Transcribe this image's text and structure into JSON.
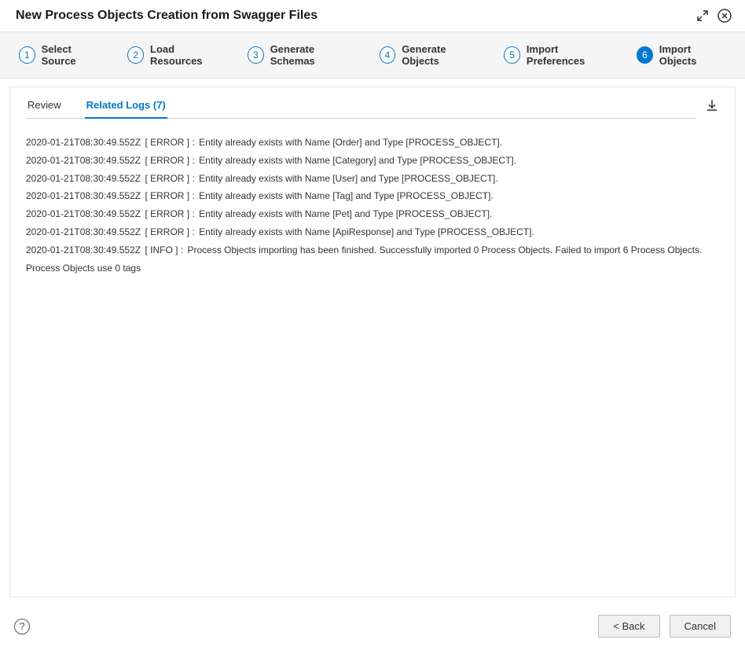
{
  "header": {
    "title": "New Process Objects Creation from Swagger Files"
  },
  "steps": [
    {
      "num": "1",
      "label": "Select Source",
      "active": false
    },
    {
      "num": "2",
      "label": "Load Resources",
      "active": false
    },
    {
      "num": "3",
      "label": "Generate Schemas",
      "active": false
    },
    {
      "num": "4",
      "label": "Generate Objects",
      "active": false
    },
    {
      "num": "5",
      "label": "Import Preferences",
      "active": false
    },
    {
      "num": "6",
      "label": "Import Objects",
      "active": true
    }
  ],
  "tabs": {
    "review": "Review",
    "related_logs": "Related Logs (7)"
  },
  "logs": [
    {
      "ts": "2020-01-21T08:30:49.552Z",
      "level": "[ ERROR ] :",
      "msg": "Entity already exists with Name [Order] and Type [PROCESS_OBJECT]."
    },
    {
      "ts": "2020-01-21T08:30:49.552Z",
      "level": "[ ERROR ] :",
      "msg": "Entity already exists with Name [Category] and Type [PROCESS_OBJECT]."
    },
    {
      "ts": "2020-01-21T08:30:49.552Z",
      "level": "[ ERROR ] :",
      "msg": "Entity already exists with Name [User] and Type [PROCESS_OBJECT]."
    },
    {
      "ts": "2020-01-21T08:30:49.552Z",
      "level": "[ ERROR ] :",
      "msg": "Entity already exists with Name [Tag] and Type [PROCESS_OBJECT]."
    },
    {
      "ts": "2020-01-21T08:30:49.552Z",
      "level": "[ ERROR ] :",
      "msg": "Entity already exists with Name [Pet] and Type [PROCESS_OBJECT]."
    },
    {
      "ts": "2020-01-21T08:30:49.552Z",
      "level": "[ ERROR ] :",
      "msg": "Entity already exists with Name [ApiResponse] and Type [PROCESS_OBJECT]."
    },
    {
      "ts": "2020-01-21T08:30:49.552Z",
      "level": "[ INFO ] :",
      "msg": "Process Objects importing has been finished. Successfully imported 0 Process Objects. Failed to import 6 Process Objects. Process Objects use 0 tags"
    }
  ],
  "footer": {
    "back": "< Back",
    "cancel": "Cancel"
  }
}
